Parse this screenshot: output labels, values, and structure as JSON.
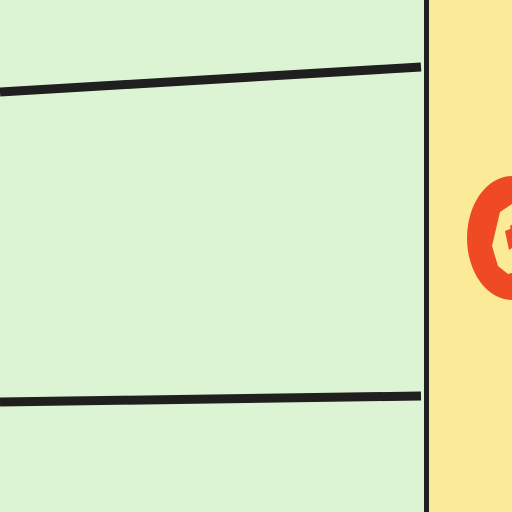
{
  "canvas": {
    "left_panel_color": "#dcf4d3",
    "right_panel_color": "#fbeb98",
    "divider_color": "#1f1f1f",
    "accent_color": "#ef4a23"
  },
  "icons": {
    "right_badge": "red-outlined-mascot-icon"
  }
}
